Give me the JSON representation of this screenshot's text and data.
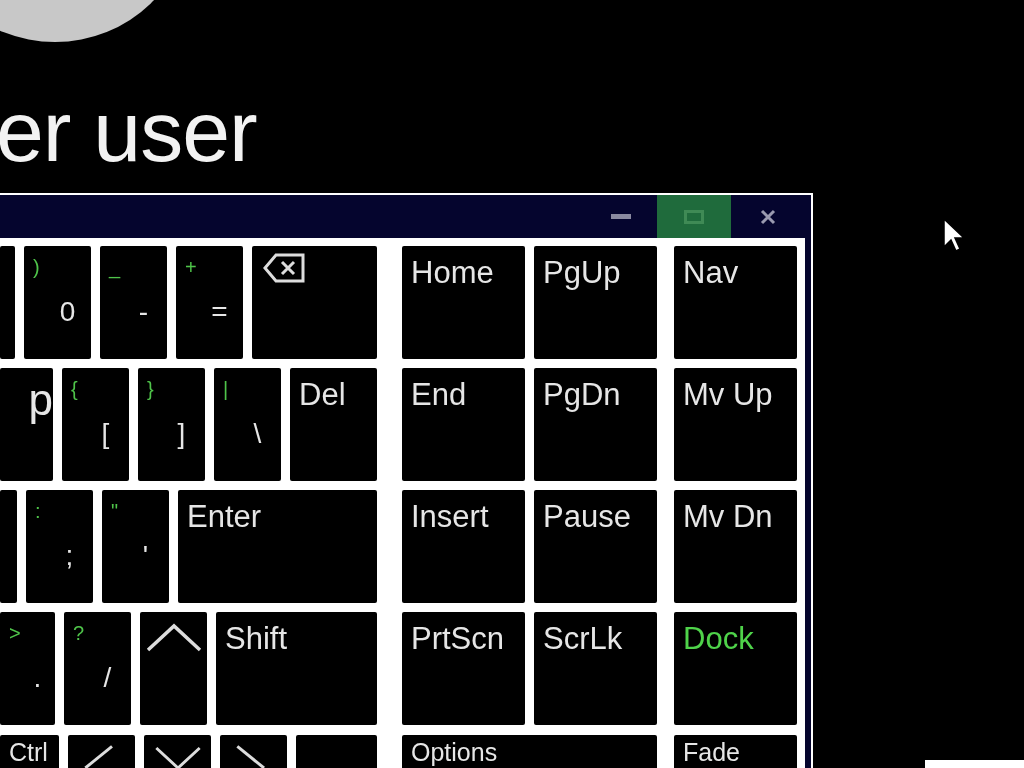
{
  "account_name": "er user",
  "keyboard": {
    "window_buttons": [
      {
        "kind": "minimize",
        "hovered": false
      },
      {
        "kind": "maximize",
        "hovered": true
      },
      {
        "kind": "close",
        "hovered": false
      }
    ],
    "main_rows": [
      [
        {
          "kind": "blank"
        },
        {
          "kind": "char",
          "shift": ")",
          "main": "0"
        },
        {
          "kind": "char",
          "shift": "_",
          "main": "-"
        },
        {
          "kind": "char",
          "shift": "+",
          "main": "="
        },
        {
          "kind": "backspace"
        }
      ],
      [
        {
          "kind": "label",
          "label": "p"
        },
        {
          "kind": "char",
          "shift": "{",
          "main": "["
        },
        {
          "kind": "char",
          "shift": "}",
          "main": "]"
        },
        {
          "kind": "char",
          "shift": "|",
          "main": "\\"
        },
        {
          "kind": "label",
          "label": "Del"
        }
      ],
      [
        {
          "kind": "blank"
        },
        {
          "kind": "char",
          "shift": ":",
          "main": ";"
        },
        {
          "kind": "char",
          "shift": "\"",
          "main": "'"
        },
        {
          "kind": "label",
          "label": "Enter"
        }
      ],
      [
        {
          "kind": "char",
          "shift": ">",
          "main": "."
        },
        {
          "kind": "char",
          "shift": "?",
          "main": "/"
        },
        {
          "kind": "arrow-up"
        },
        {
          "kind": "label",
          "label": "Shift"
        }
      ],
      [
        {
          "kind": "label",
          "label": "Ctrl"
        },
        {
          "kind": "arrow-left"
        },
        {
          "kind": "arrow-down"
        },
        {
          "kind": "arrow-right"
        },
        {
          "kind": "blank"
        }
      ]
    ],
    "side_rows": [
      [
        {
          "label": "Home",
          "on": false
        },
        {
          "label": "PgUp",
          "on": false
        },
        {
          "label": "Nav",
          "on": false
        }
      ],
      [
        {
          "label": "End",
          "on": false
        },
        {
          "label": "PgDn",
          "on": false
        },
        {
          "label": "Mv Up",
          "on": false
        }
      ],
      [
        {
          "label": "Insert",
          "on": false
        },
        {
          "label": "Pause",
          "on": false
        },
        {
          "label": "Mv Dn",
          "on": false
        }
      ],
      [
        {
          "label": "PrtScn",
          "on": false
        },
        {
          "label": "ScrLk",
          "on": false
        },
        {
          "label": "Dock",
          "on": true
        }
      ],
      [
        {
          "label": "Options",
          "on": false
        },
        {
          "label": "Fade",
          "on": false
        }
      ]
    ]
  }
}
